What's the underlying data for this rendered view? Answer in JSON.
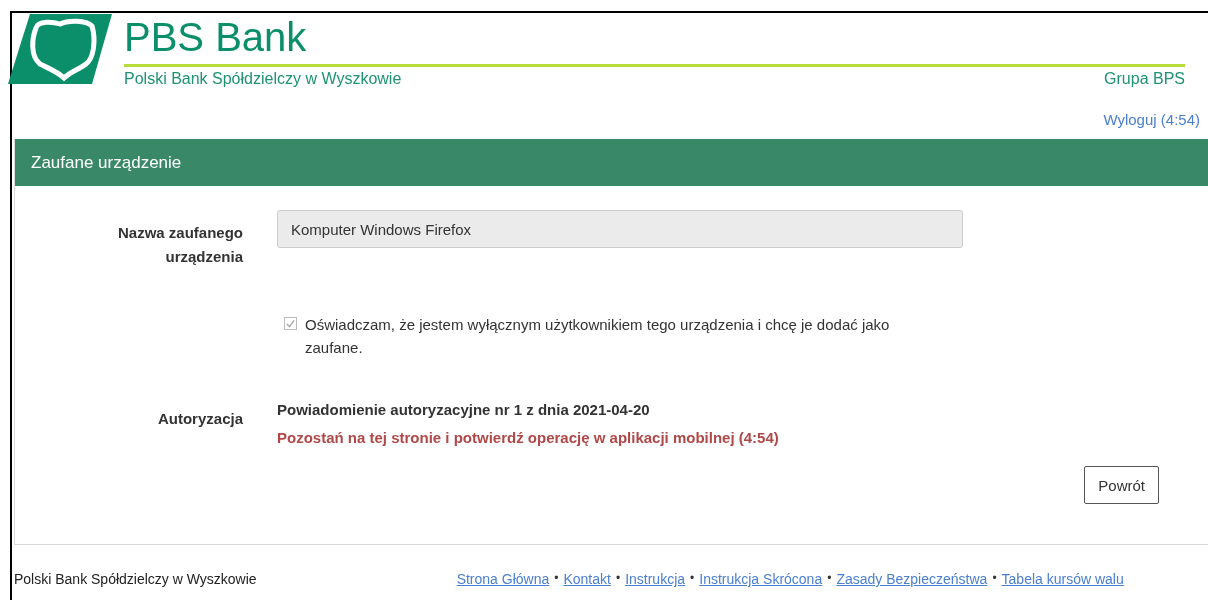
{
  "header": {
    "brand": "PBS Bank",
    "subtitle": "Polski Bank Spółdzielczy w Wyszkowie",
    "group": "Grupa BPS",
    "logout": "Wyloguj (4:54)"
  },
  "panel": {
    "title": "Zaufane urządzenie",
    "device_name": {
      "label": "Nazwa zaufanego urządzenia",
      "value": "Komputer Windows Firefox",
      "disabled": true
    },
    "declaration": {
      "label": "Oświadczam, że jestem wyłącznym użytkownikiem tego urządzenia i chcę je dodać jako zaufane.",
      "checked": true,
      "disabled": true
    },
    "authorization": {
      "label": "Autoryzacja",
      "notice": "Powiadomienie autoryzacyjne nr 1 z dnia 2021-04-20",
      "message": "Pozostań na tej stronie i potwierdź operację w aplikacji mobilnej (4:54)"
    },
    "buttons": [
      "Powrót"
    ]
  },
  "footer": {
    "bank": "Polski Bank Spółdzielczy w Wyszkowie",
    "links": [
      "Strona Główna",
      "Kontakt",
      "Instrukcja",
      "Instrukcja Skrócona",
      "Zasady Bezpieczeństwa",
      "Tabela kursów walu"
    ],
    "separator": "•"
  }
}
